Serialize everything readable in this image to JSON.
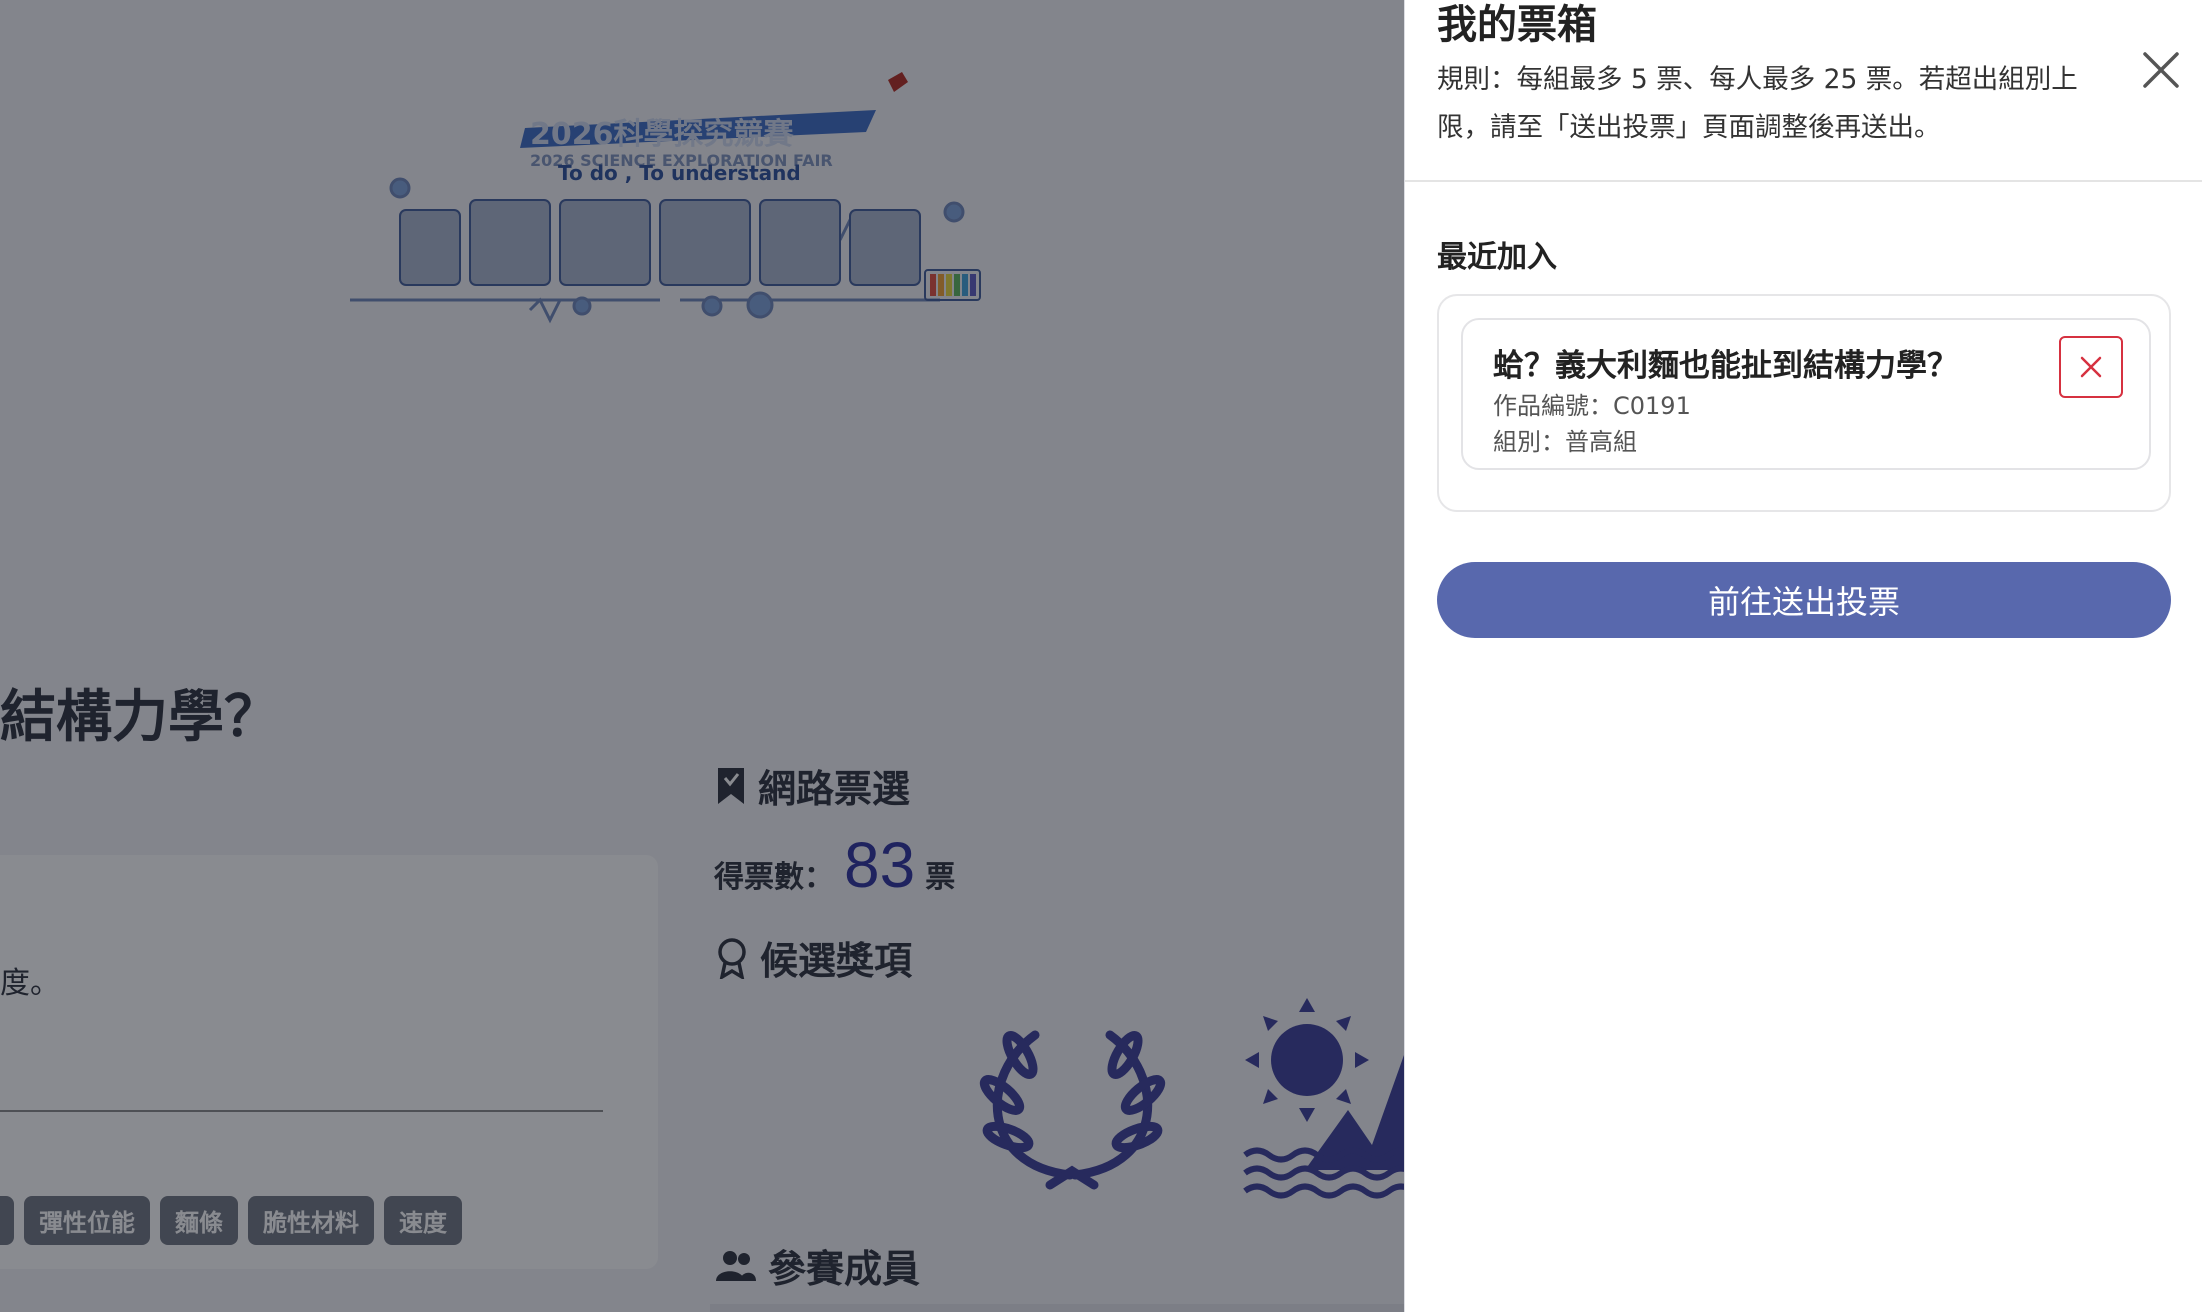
{
  "background": {
    "logo": {
      "title_zh": "2026科學探究競賽",
      "title_en": "2026 SCIENCE EXPLORATION FAIR",
      "slogan": "To do , To understand"
    },
    "project_title_fragment": "結構力學？",
    "description_fragment": "度。",
    "tags": [
      "",
      "彈性位能",
      "麵條",
      "脆性材料",
      "速度"
    ],
    "online_vote": {
      "heading": "網路票選",
      "votes_label": "得票數：",
      "votes_count": "83",
      "votes_unit": "票"
    },
    "award_heading": "候選獎項",
    "members_heading": "參賽成員"
  },
  "drawer": {
    "title": "我的票箱",
    "rules_line1": "規則：每組最多 5 票、每人最多 25 票。若超出組別上",
    "rules_line2": "限，請至「送出投票」頁面調整後再送出。",
    "recent_label": "最近加入",
    "items": [
      {
        "title": "蛤？義大利麵也能扯到結構力學？",
        "code": "作品編號：C0191",
        "group": "組別：普高組"
      }
    ],
    "submit_label": "前往送出投票"
  },
  "colors": {
    "accent": "#5868ad",
    "danger": "#d63140",
    "vote_number": "#2b2e9c",
    "award_icon": "#3a3c98"
  }
}
